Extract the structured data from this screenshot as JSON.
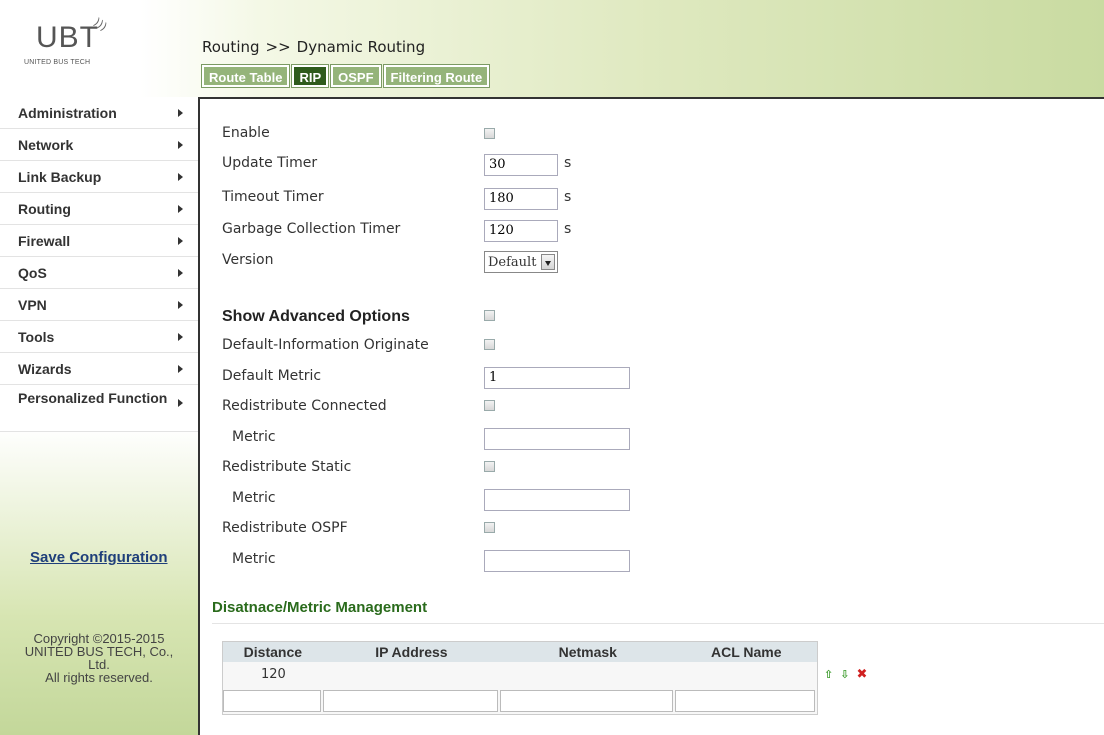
{
  "logo": {
    "mark": "UBT",
    "subtitle": "UNITED BUS TECH"
  },
  "breadcrumb": {
    "section": "Routing",
    "separator": ">>",
    "page": "Dynamic Routing"
  },
  "tabs": [
    {
      "label": "Route Table",
      "active": false
    },
    {
      "label": "RIP",
      "active": true
    },
    {
      "label": "OSPF",
      "active": false
    },
    {
      "label": "Filtering Route",
      "active": false
    }
  ],
  "sidebar": {
    "items": [
      {
        "label": "Administration"
      },
      {
        "label": "Network"
      },
      {
        "label": "Link Backup"
      },
      {
        "label": "Routing"
      },
      {
        "label": "Firewall"
      },
      {
        "label": "QoS"
      },
      {
        "label": "VPN"
      },
      {
        "label": "Tools"
      },
      {
        "label": "Wizards"
      },
      {
        "label": "Personalized Function"
      }
    ],
    "save_label": "Save Configuration",
    "copyright": [
      "Copyright ©2015-2015",
      "UNITED BUS TECH, Co.,",
      "Ltd.",
      "All rights reserved."
    ]
  },
  "rip": {
    "enable": {
      "label": "Enable",
      "checked": false
    },
    "update_timer": {
      "label": "Update Timer",
      "value": "30",
      "unit": "s"
    },
    "timeout_timer": {
      "label": "Timeout Timer",
      "value": "180",
      "unit": "s"
    },
    "garbage_timer": {
      "label": "Garbage Collection Timer",
      "value": "120",
      "unit": "s"
    },
    "version": {
      "label": "Version",
      "selected": "Default"
    },
    "advanced": {
      "label": "Show Advanced Options",
      "checked": false
    },
    "default_info": {
      "label": "Default-Information Originate",
      "checked": false
    },
    "default_metric": {
      "label": "Default Metric",
      "value": "1"
    },
    "redist_connected": {
      "label": "Redistribute Connected",
      "checked": false,
      "metric_label": "Metric",
      "metric_value": ""
    },
    "redist_static": {
      "label": "Redistribute Static",
      "checked": false,
      "metric_label": "Metric",
      "metric_value": ""
    },
    "redist_ospf": {
      "label": "Redistribute OSPF",
      "checked": false,
      "metric_label": "Metric",
      "metric_value": ""
    }
  },
  "dm": {
    "title": "Disatnace/Metric Management",
    "columns": [
      "Distance",
      "IP Address",
      "Netmask",
      "ACL Name"
    ],
    "rows": [
      {
        "distance": "120",
        "ip": "",
        "netmask": "",
        "acl": ""
      }
    ],
    "actions": {
      "up": "⇧",
      "down": "⇩",
      "delete": "✖"
    }
  }
}
